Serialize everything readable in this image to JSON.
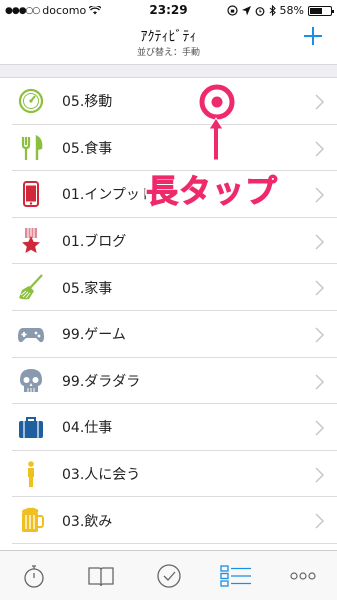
{
  "status_bar": {
    "carrier": "docomo",
    "time": "23:29",
    "battery": "58%"
  },
  "nav": {
    "title": "ｱｸﾃｨﾋﾞﾃｨ",
    "subtitle": "並び替え：手動"
  },
  "activities": [
    {
      "label": "05.移動",
      "icon": "clock-icon",
      "color": "#8cbf3f"
    },
    {
      "label": "05.食事",
      "icon": "fork-knife-icon",
      "color": "#8cbf3f"
    },
    {
      "label": "01.インプット",
      "icon": "smartphone-icon",
      "color": "#d1273a"
    },
    {
      "label": "01.ブログ",
      "icon": "star-ribbon-icon",
      "color": "#d1273a"
    },
    {
      "label": "05.家事",
      "icon": "broom-icon",
      "color": "#8cbf3f"
    },
    {
      "label": "99.ゲーム",
      "icon": "gamepad-icon",
      "color": "#8a9aae"
    },
    {
      "label": "99.ダラダラ",
      "icon": "skull-icon",
      "color": "#8a9aae"
    },
    {
      "label": "04.仕事",
      "icon": "briefcase-icon",
      "color": "#1f5fa0"
    },
    {
      "label": "03.人に会う",
      "icon": "person-icon",
      "color": "#f0c020"
    },
    {
      "label": "03.飲み",
      "icon": "beer-icon",
      "color": "#f0c020"
    }
  ],
  "annotation": {
    "text": "長タップ",
    "color": "#ee2a6b"
  },
  "tab_bar": [
    {
      "icon": "stopwatch-icon",
      "active": false
    },
    {
      "icon": "book-icon",
      "active": false
    },
    {
      "icon": "check-circle-icon",
      "active": false
    },
    {
      "icon": "list-icon",
      "active": true
    },
    {
      "icon": "more-icon",
      "active": false
    }
  ]
}
